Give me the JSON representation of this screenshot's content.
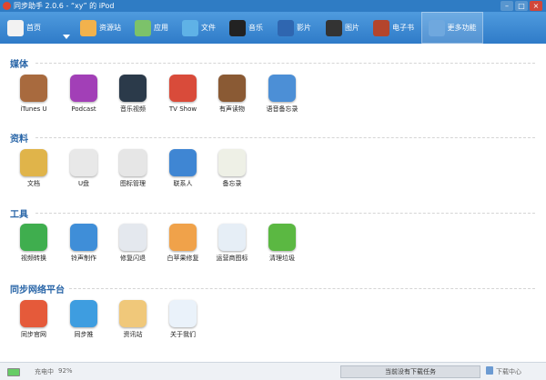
{
  "window": {
    "title": "同步助手 2.0.6 - “xy” 的 iPod",
    "controls": {
      "minimize": "–",
      "maximize": "□",
      "close": "×"
    }
  },
  "nav": {
    "items": [
      {
        "label": "首页",
        "icon": "home-icon",
        "color": "#f2f2f2"
      },
      {
        "label": "资源站",
        "icon": "shop-icon",
        "color": "#f2b24c"
      },
      {
        "label": "应用",
        "icon": "apps-icon",
        "color": "#7cc26a"
      },
      {
        "label": "文件",
        "icon": "file-icon",
        "color": "#5fb2e6"
      },
      {
        "label": "音乐",
        "icon": "music-icon",
        "color": "#222222"
      },
      {
        "label": "影片",
        "icon": "video-icon",
        "color": "#2f66b0"
      },
      {
        "label": "图片",
        "icon": "photo-icon",
        "color": "#333333"
      },
      {
        "label": "电子书",
        "icon": "ebook-icon",
        "color": "#b4452c"
      },
      {
        "label": "更多功能",
        "icon": "more-icon",
        "color": "#6fa8de"
      }
    ],
    "active": "更多功能"
  },
  "sections": [
    {
      "title": "媒体",
      "items": [
        {
          "label": "iTunes U",
          "icon": "itunes-u-icon",
          "color": "#a86a3e"
        },
        {
          "label": "Podcast",
          "icon": "podcast-icon",
          "color": "#a23fb7"
        },
        {
          "label": "音乐视频",
          "icon": "music-video-icon",
          "color": "#2b3a4a"
        },
        {
          "label": "TV Show",
          "icon": "tv-show-icon",
          "color": "#d94b3a"
        },
        {
          "label": "有声读物",
          "icon": "audiobook-icon",
          "color": "#8a5a34"
        },
        {
          "label": "语音备忘录",
          "icon": "voice-memo-icon",
          "color": "#4c8fd6"
        }
      ]
    },
    {
      "title": "资料",
      "items": [
        {
          "label": "文档",
          "icon": "document-icon",
          "color": "#e0b44a"
        },
        {
          "label": "U盘",
          "icon": "udisk-icon",
          "color": "#e8e8e8"
        },
        {
          "label": "图标管理",
          "icon": "icon-manage-icon",
          "color": "#e6e6e6"
        },
        {
          "label": "联系人",
          "icon": "contacts-icon",
          "color": "#3f86d3"
        },
        {
          "label": "备忘录",
          "icon": "notes-icon",
          "color": "#eef0e6"
        }
      ]
    },
    {
      "title": "工具",
      "items": [
        {
          "label": "视频转换",
          "icon": "video-convert-icon",
          "color": "#3fae4e"
        },
        {
          "label": "铃声制作",
          "icon": "ringtone-icon",
          "color": "#3f8ed8"
        },
        {
          "label": "修复闪退",
          "icon": "fix-crash-icon",
          "color": "#e4e8ee"
        },
        {
          "label": "白苹果修复",
          "icon": "white-apple-fix-icon",
          "color": "#f0a24a"
        },
        {
          "label": "运营商图标",
          "icon": "carrier-icon",
          "color": "#e6eef6"
        },
        {
          "label": "清理垃圾",
          "icon": "clean-icon",
          "color": "#5bb842"
        }
      ]
    },
    {
      "title": "同步网络平台",
      "items": [
        {
          "label": "同步官网",
          "icon": "website-icon",
          "color": "#e55a3a"
        },
        {
          "label": "同步推",
          "icon": "tui-icon",
          "color": "#3e9de0"
        },
        {
          "label": "资讯站",
          "icon": "news-icon",
          "color": "#f0c87a"
        },
        {
          "label": "关于我们",
          "icon": "about-icon",
          "color": "#eaf2fa"
        }
      ]
    }
  ],
  "status": {
    "charging": "充电中",
    "battery": "92%",
    "task": "当前没有下载任务",
    "download_center": "下载中心"
  }
}
